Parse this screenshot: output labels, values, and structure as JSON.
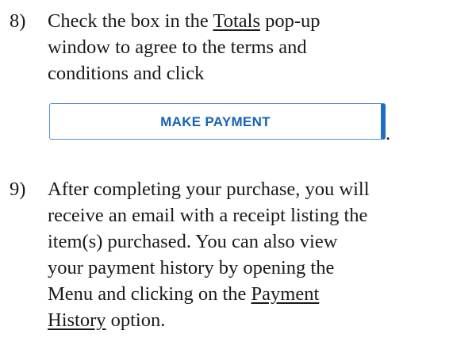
{
  "steps": [
    {
      "number": "8)",
      "line1": "Check the box in the ",
      "link": "Totals",
      "line1_tail": " pop-up",
      "line2": "window to agree to the terms and",
      "line3": "conditions and click",
      "button_label": "MAKE PAYMENT",
      "trailing": "."
    },
    {
      "number": "9)",
      "lines": [
        "After completing your purchase, you will",
        "receive an email with a receipt listing the",
        "item(s) purchased.  You can also view",
        "your payment history by opening the"
      ],
      "line5_head": "Menu and clicking on the ",
      "link_part1": "Payment",
      "link_part2": "History",
      "line6_tail": " option."
    }
  ],
  "colors": {
    "button_text": "#1563b3",
    "button_border": "#5a8fd0",
    "button_accent": "#1e6fc4"
  }
}
